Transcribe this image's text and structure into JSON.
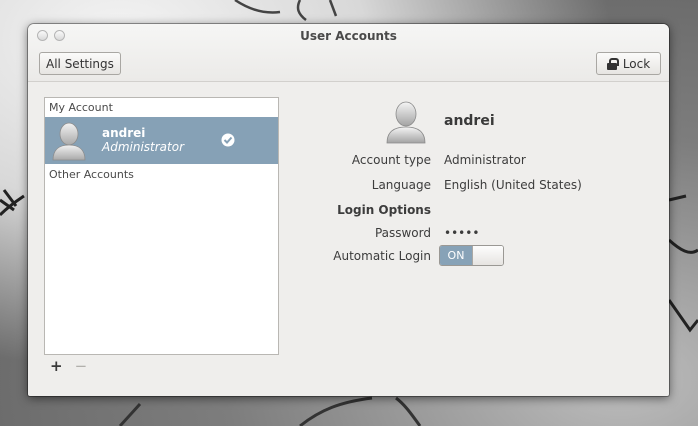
{
  "window": {
    "title": "User Accounts"
  },
  "toolbar": {
    "all_settings_label": "All Settings",
    "lock_label": "Lock"
  },
  "accounts": {
    "my_account_label": "My Account",
    "selected_user": {
      "name": "andrei",
      "role": "Administrator",
      "icon": "check-circle-icon"
    },
    "other_accounts_label": "Other Accounts",
    "add_symbol": "+",
    "remove_symbol": "−"
  },
  "details": {
    "name": "andrei",
    "account_type_label": "Account type",
    "account_type_value": "Administrator",
    "language_label": "Language",
    "language_value": "English (United States)",
    "login_options_label": "Login Options",
    "password_label": "Password",
    "password_value": "•••••",
    "automatic_login_label": "Automatic Login",
    "automatic_login_state": "ON"
  },
  "colors": {
    "selection": "#86a1b6",
    "window_bg": "#efeeec"
  }
}
